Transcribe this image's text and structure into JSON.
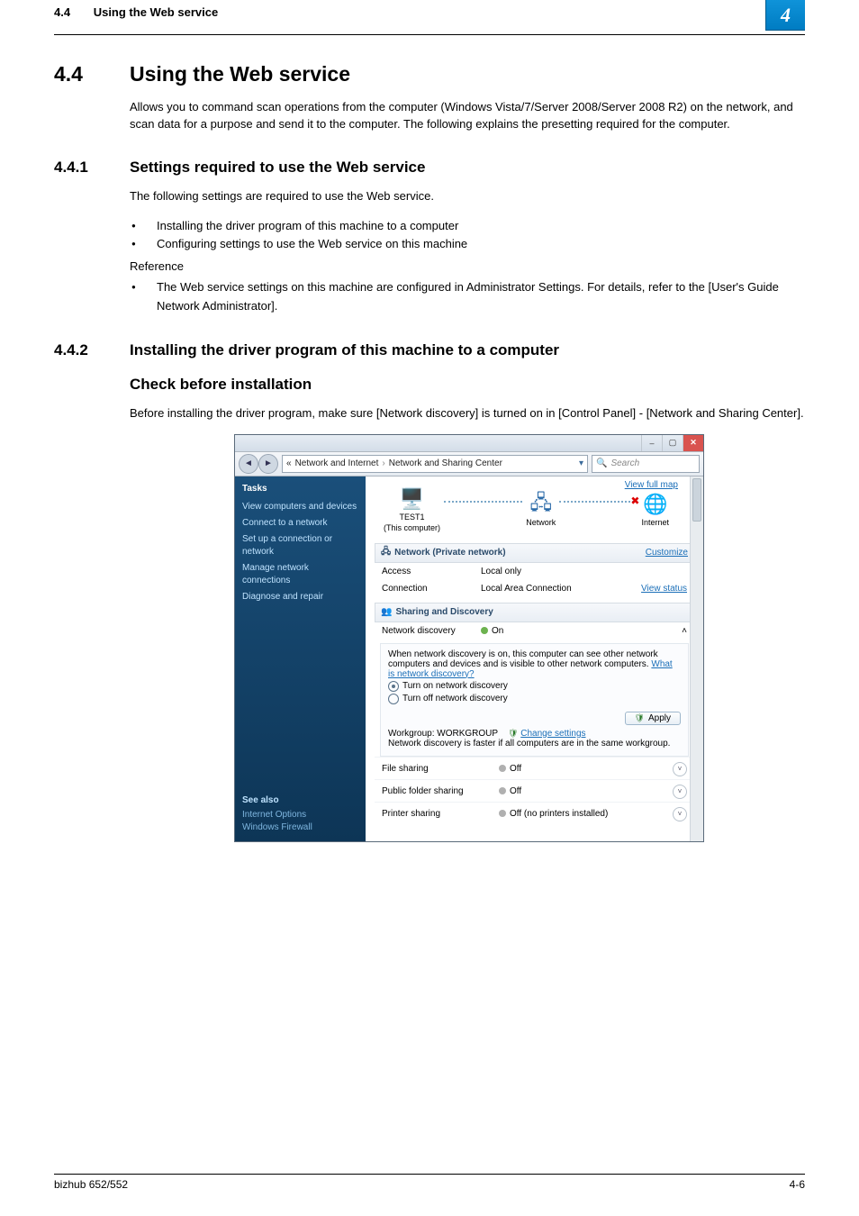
{
  "header": {
    "section_no": "4.4",
    "section_title": "Using the Web service",
    "chapter_badge": "4"
  },
  "h1": {
    "num": "4.4",
    "title": "Using the Web service"
  },
  "intro": "Allows you to command scan operations from the computer (Windows Vista/7/Server 2008/Server 2008 R2) on the network, and scan data for a purpose and send it to the computer. The following explains the presetting required for the computer.",
  "h2a": {
    "num": "4.4.1",
    "title": "Settings required to use the Web service"
  },
  "h2a_lead": "The following settings are required to use the Web service.",
  "h2a_bullets": [
    "Installing the driver program of this machine to a computer",
    "Configuring settings to use the Web service on this machine"
  ],
  "reference_label": "Reference",
  "reference_bullets": [
    "The Web service settings on this machine are configured in Administrator Settings. For details, refer to the [User's Guide Network Administrator]."
  ],
  "h2b": {
    "num": "4.4.2",
    "title": "Installing the driver program of this machine to a computer"
  },
  "h3": "Check before installation",
  "h3_lead": "Before installing the driver program, make sure [Network discovery] is turned on in [Control Panel] - [Network and Sharing Center].",
  "screenshot": {
    "breadcrumb": {
      "prefix": "«",
      "seg1": "Network and Internet",
      "sep": "›",
      "seg2": "Network and Sharing Center"
    },
    "search_placeholder": "Search",
    "tasks_label": "Tasks",
    "tasks": [
      "View computers and devices",
      "Connect to a network",
      "Set up a connection or network",
      "Manage network connections",
      "Diagnose and repair"
    ],
    "see_also_label": "See also",
    "see_also": [
      "Internet Options",
      "Windows Firewall"
    ],
    "view_full_map": "View full map",
    "nodes": {
      "this_pc_name": "TEST1",
      "this_pc_sub": "(This computer)",
      "network_label": "Network",
      "internet_label": "Internet"
    },
    "network_section": {
      "title": "Network (Private network)",
      "customize": "Customize",
      "access_k": "Access",
      "access_v": "Local only",
      "connection_k": "Connection",
      "connection_v": "Local Area Connection",
      "view_status": "View status"
    },
    "sharing_section": {
      "title": "Sharing and Discovery",
      "netdisc_k": "Network discovery",
      "netdisc_v": "On",
      "desc": "When network discovery is on, this computer can see other network computers and devices and is visible to other network computers. ",
      "desc_link": "What is network discovery?",
      "opt_on": "Turn on network discovery",
      "opt_off": "Turn off network discovery",
      "apply": "Apply",
      "workgroup_line_a": "Workgroup: WORKGROUP",
      "workgroup_link": "Change settings",
      "workgroup_note": "Network discovery is faster if all computers are in the same workgroup."
    },
    "rows": [
      {
        "label": "File sharing",
        "value": "Off",
        "dot": "off"
      },
      {
        "label": "Public folder sharing",
        "value": "Off",
        "dot": "off"
      },
      {
        "label": "Printer sharing",
        "value": "Off (no printers installed)",
        "dot": "off"
      }
    ]
  },
  "footer": {
    "left": "bizhub 652/552",
    "right": "4-6"
  }
}
